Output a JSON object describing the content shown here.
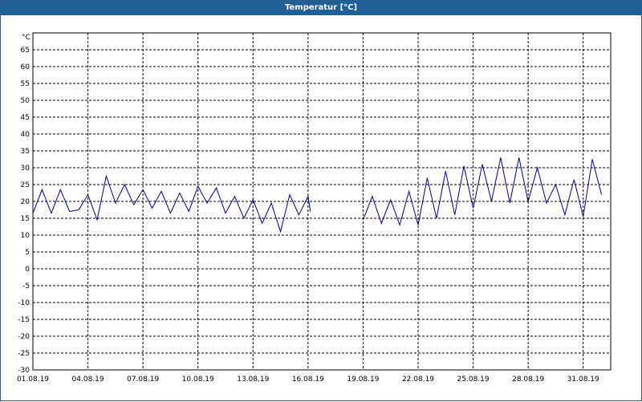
{
  "window": {
    "title": "Temperatur [°C]"
  },
  "chart_data": {
    "type": "line",
    "title": "Temperatur [°C]",
    "ylabel": "°C",
    "xlabel": "",
    "ylim": [
      -30,
      70
    ],
    "yticks": [
      65,
      60,
      55,
      50,
      45,
      40,
      35,
      30,
      25,
      20,
      15,
      10,
      5,
      0,
      -5,
      -10,
      -15,
      -20,
      -25,
      -30
    ],
    "xlim": [
      "2019-08-01",
      "2019-09-01T12:00"
    ],
    "xtick_labels": [
      "01.08.19",
      "04.08.19",
      "07.08.19",
      "10.08.19",
      "13.08.19",
      "16.08.19",
      "19.08.19",
      "22.08.19",
      "25.08.19",
      "28.08.19",
      "31.08.19"
    ],
    "grid": true,
    "series_color": "#00008b",
    "series": [
      {
        "values": [
          [
            [
              "2019-08-01",
              16.5
            ],
            [
              "2019-08-01T12:00",
              23.5
            ],
            [
              "2019-08-02",
              16.5
            ],
            [
              "2019-08-02T12:00",
              23.5
            ],
            [
              "2019-08-03",
              17
            ],
            [
              "2019-08-03T12:00",
              17.5
            ],
            [
              "2019-08-04",
              22
            ],
            [
              "2019-08-04T12:00",
              14.5
            ],
            [
              "2019-08-05",
              27.5
            ],
            [
              "2019-08-05T12:00",
              19.5
            ],
            [
              "2019-08-06",
              25
            ],
            [
              "2019-08-06T12:00",
              19
            ],
            [
              "2019-08-07",
              23.5
            ],
            [
              "2019-08-07T12:00",
              18
            ],
            [
              "2019-08-08",
              23
            ],
            [
              "2019-08-08T12:00",
              16.5
            ],
            [
              "2019-08-09",
              22.5
            ],
            [
              "2019-08-09T12:00",
              17
            ],
            [
              "2019-08-10",
              24.5
            ],
            [
              "2019-08-10T12:00",
              19.5
            ],
            [
              "2019-08-11",
              24
            ],
            [
              "2019-08-11T12:00",
              16.5
            ],
            [
              "2019-08-12",
              21.5
            ],
            [
              "2019-08-12T12:00",
              15
            ],
            [
              "2019-08-13",
              20.5
            ],
            [
              "2019-08-13T12:00",
              13.5
            ],
            [
              "2019-08-14",
              19.5
            ],
            [
              "2019-08-14T12:00",
              11
            ],
            [
              "2019-08-15",
              22
            ],
            [
              "2019-08-15T12:00",
              16
            ],
            [
              "2019-08-16",
              21.5
            ],
            [
              "2019-08-16T03:00",
              17
            ]
          ],
          [
            [
              "2019-08-19",
              14.5
            ],
            [
              "2019-08-19T12:00",
              21.5
            ],
            [
              "2019-08-20",
              13.5
            ],
            [
              "2019-08-20T12:00",
              20.5
            ],
            [
              "2019-08-21",
              13
            ],
            [
              "2019-08-21T12:00",
              23
            ],
            [
              "2019-08-22",
              13
            ],
            [
              "2019-08-22T12:00",
              27
            ],
            [
              "2019-08-23",
              15
            ],
            [
              "2019-08-23T12:00",
              29
            ],
            [
              "2019-08-24",
              16
            ],
            [
              "2019-08-24T12:00",
              30.5
            ],
            [
              "2019-08-25",
              18
            ],
            [
              "2019-08-25T12:00",
              31
            ],
            [
              "2019-08-26",
              20
            ],
            [
              "2019-08-26T12:00",
              33
            ],
            [
              "2019-08-27",
              19.5
            ],
            [
              "2019-08-27T12:00",
              33
            ],
            [
              "2019-08-28",
              20
            ],
            [
              "2019-08-28T12:00",
              30
            ],
            [
              "2019-08-29",
              19.5
            ],
            [
              "2019-08-29T12:00",
              25
            ],
            [
              "2019-08-30",
              16
            ],
            [
              "2019-08-30T12:00",
              26.5
            ],
            [
              "2019-08-31",
              15.5
            ],
            [
              "2019-08-31T12:00",
              32.5
            ],
            [
              "2019-09-01",
              22
            ]
          ]
        ]
      }
    ]
  }
}
